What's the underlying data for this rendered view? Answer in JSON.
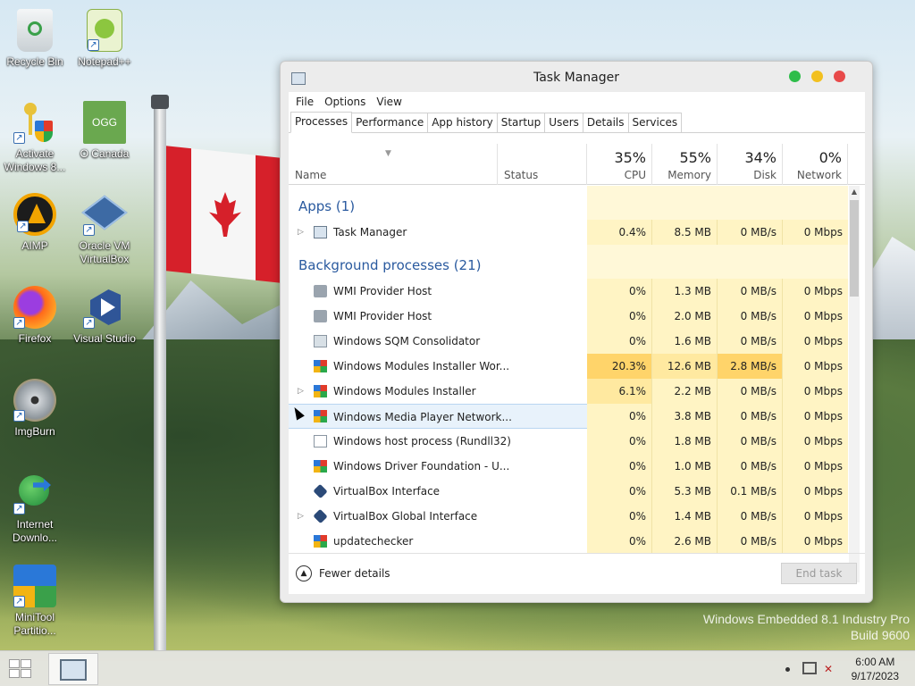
{
  "desktop": {
    "icons": [
      {
        "label": "Recycle Bin",
        "icon": "recycle-bin-icon"
      },
      {
        "label": "Notepad++",
        "icon": "notepadpp-icon"
      },
      {
        "label": "Activate Windows 8...",
        "icon": "key-shield-icon"
      },
      {
        "label": "O Canada",
        "icon": "ogg-file-icon",
        "badge": "OGG"
      },
      {
        "label": "AIMP",
        "icon": "aimp-icon"
      },
      {
        "label": "Oracle VM VirtualBox",
        "icon": "virtualbox-icon"
      },
      {
        "label": "Firefox",
        "icon": "firefox-icon"
      },
      {
        "label": "Visual Studio",
        "icon": "visual-studio-icon"
      },
      {
        "label": "ImgBurn",
        "icon": "imgburn-icon"
      },
      {
        "label": "Internet Downlo...",
        "icon": "internet-download-manager-icon"
      },
      {
        "label": "MiniTool Partitio...",
        "icon": "minitool-partition-icon"
      }
    ],
    "watermark_line1": "Windows Embedded 8.1 Industry Pro",
    "watermark_line2": "Build 9600"
  },
  "window": {
    "title": "Task Manager",
    "menu": [
      "File",
      "Options",
      "View"
    ],
    "tabs": [
      "Processes",
      "Performance",
      "App history",
      "Startup",
      "Users",
      "Details",
      "Services"
    ],
    "active_tab": "Processes",
    "columns": {
      "name": "Name",
      "status": "Status",
      "cpu_pct": "35%",
      "cpu": "CPU",
      "mem_pct": "55%",
      "mem": "Memory",
      "disk_pct": "34%",
      "disk": "Disk",
      "net_pct": "0%",
      "net": "Network"
    },
    "groups": {
      "apps": "Apps (1)",
      "background": "Background processes (21)"
    },
    "apps": [
      {
        "name": "Task Manager",
        "cpu": "0.4%",
        "mem": "8.5 MB",
        "disk": "0 MB/s",
        "net": "0 Mbps",
        "expandable": true,
        "icon": "task-manager-icon"
      }
    ],
    "background": [
      {
        "name": "WMI Provider Host",
        "cpu": "0%",
        "mem": "1.3 MB",
        "disk": "0 MB/s",
        "net": "0 Mbps",
        "icon": "wmi-icon"
      },
      {
        "name": "WMI Provider Host",
        "cpu": "0%",
        "mem": "2.0 MB",
        "disk": "0 MB/s",
        "net": "0 Mbps",
        "icon": "wmi-icon"
      },
      {
        "name": "Windows SQM Consolidator",
        "cpu": "0%",
        "mem": "1.6 MB",
        "disk": "0 MB/s",
        "net": "0 Mbps",
        "icon": "sqm-icon"
      },
      {
        "name": "Windows Modules Installer Wor...",
        "cpu": "20.3%",
        "mem": "12.6 MB",
        "disk": "2.8 MB/s",
        "net": "0 Mbps",
        "icon": "windows-process-icon"
      },
      {
        "name": "Windows Modules Installer",
        "cpu": "6.1%",
        "mem": "2.2 MB",
        "disk": "0 MB/s",
        "net": "0 Mbps",
        "expandable": true,
        "icon": "windows-process-icon"
      },
      {
        "name": "Windows Media Player Network...",
        "cpu": "0%",
        "mem": "3.8 MB",
        "disk": "0 MB/s",
        "net": "0 Mbps",
        "expandable": true,
        "selected": true,
        "icon": "windows-process-icon"
      },
      {
        "name": "Windows host process (Rundll32)",
        "cpu": "0%",
        "mem": "1.8 MB",
        "disk": "0 MB/s",
        "net": "0 Mbps",
        "icon": "document-icon"
      },
      {
        "name": "Windows Driver Foundation - U...",
        "cpu": "0%",
        "mem": "1.0 MB",
        "disk": "0 MB/s",
        "net": "0 Mbps",
        "icon": "windows-process-icon"
      },
      {
        "name": "VirtualBox Interface",
        "cpu": "0%",
        "mem": "5.3 MB",
        "disk": "0.1 MB/s",
        "net": "0 Mbps",
        "icon": "virtualbox-icon"
      },
      {
        "name": "VirtualBox Global Interface",
        "cpu": "0%",
        "mem": "1.4 MB",
        "disk": "0 MB/s",
        "net": "0 Mbps",
        "expandable": true,
        "icon": "virtualbox-icon"
      },
      {
        "name": "updatechecker",
        "cpu": "0%",
        "mem": "2.6 MB",
        "disk": "0 MB/s",
        "net": "0 Mbps",
        "icon": "windows-process-icon"
      }
    ],
    "footer": {
      "fewer_details": "Fewer details",
      "end_task": "End task"
    }
  },
  "taskbar": {
    "time": "6:00 AM",
    "date": "9/17/2023"
  }
}
